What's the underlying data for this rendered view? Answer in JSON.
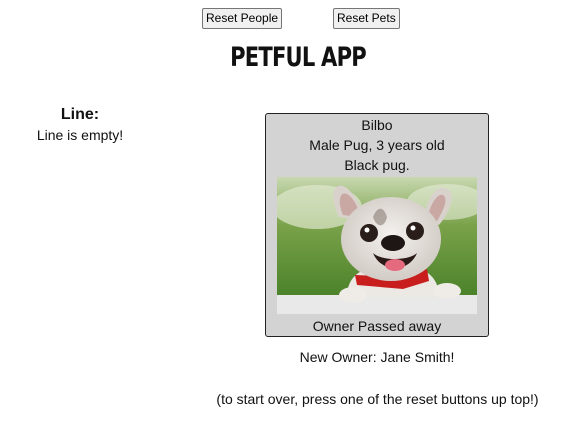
{
  "header": {
    "reset_people_label": "Reset People",
    "reset_pets_label": "Reset Pets",
    "title": "PETFUL APP"
  },
  "line": {
    "heading": "Line:",
    "status": "Line is empty!"
  },
  "pet": {
    "name": "Bilbo",
    "details": "Male Pug, 3 years old",
    "description": "Black pug.",
    "image_alt": "French bulldog photo",
    "fate": "Owner Passed away"
  },
  "adoption": {
    "new_owner": "New Owner: Jane Smith!",
    "hint": "(to start over, press one of the reset buttons up top!)"
  },
  "colors": {
    "card_background": "#d3d3d3",
    "page_background": "#ffffff"
  }
}
